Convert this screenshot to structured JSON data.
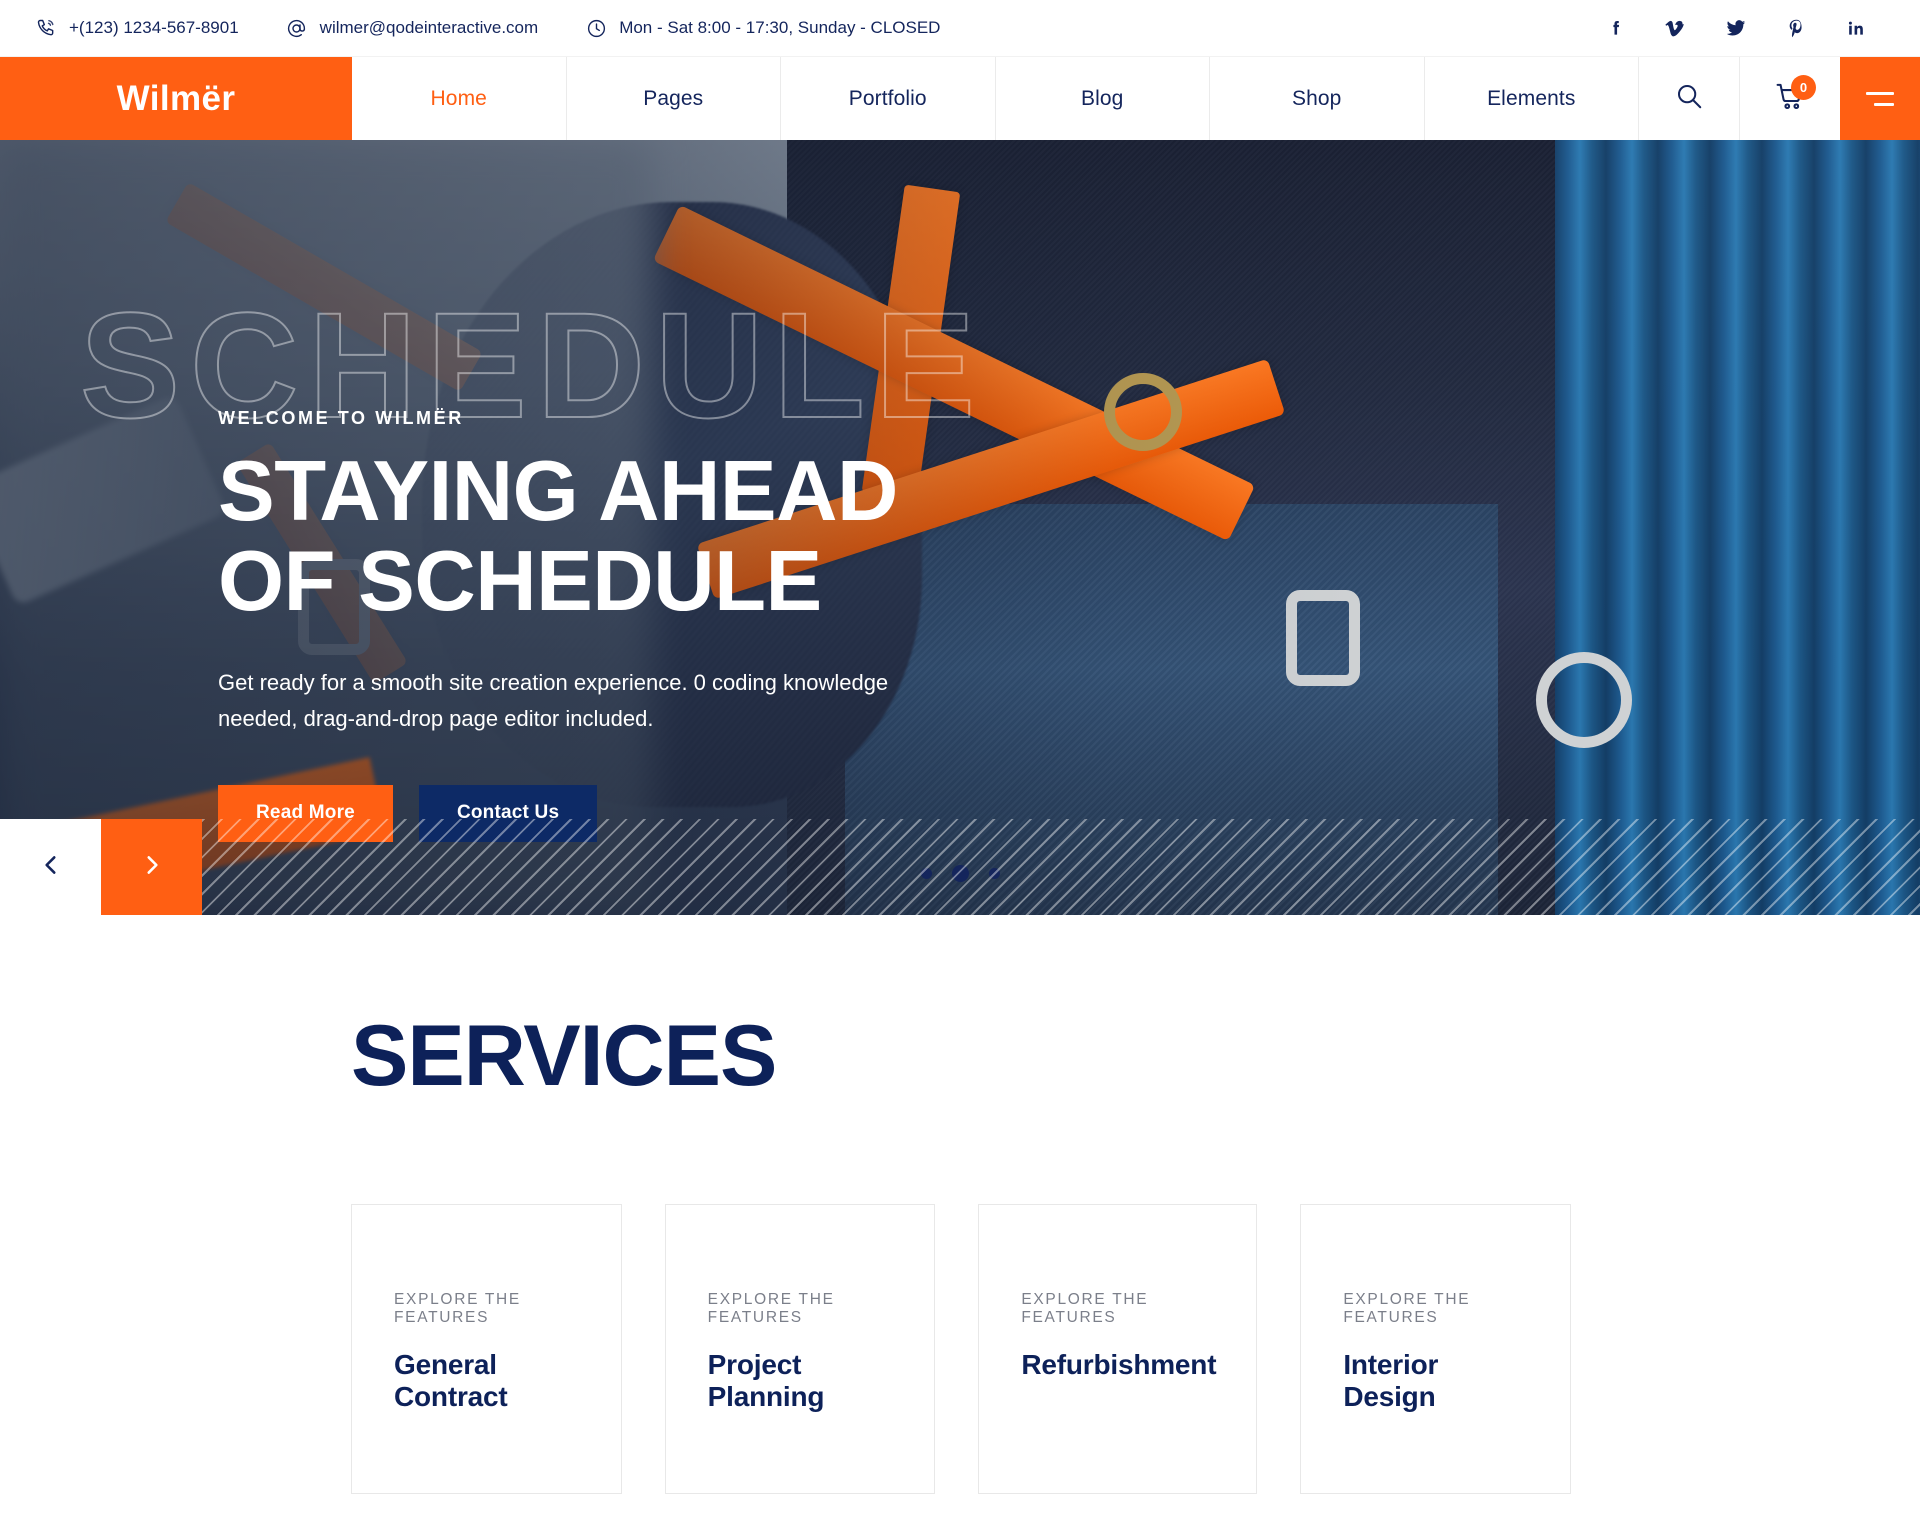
{
  "topbar": {
    "phone": "+(123) 1234-567-8901",
    "email": "wilmer@qodeinteractive.com",
    "hours": "Mon - Sat 8:00 - 17:30, Sunday - CLOSED",
    "icons": {
      "phone": "phone-icon",
      "email": "at-sign-icon",
      "clock": "clock-icon"
    },
    "social": [
      {
        "name": "facebook-icon",
        "glyph": "f"
      },
      {
        "name": "vimeo-icon",
        "glyph": "V"
      },
      {
        "name": "twitter-icon",
        "glyph": "t"
      },
      {
        "name": "pinterest-icon",
        "glyph": "P"
      },
      {
        "name": "linkedin-icon",
        "glyph": "in"
      }
    ]
  },
  "nav": {
    "logo": "Wilmër",
    "items": [
      {
        "label": "Home",
        "active": true
      },
      {
        "label": "Pages",
        "active": false
      },
      {
        "label": "Portfolio",
        "active": false
      },
      {
        "label": "Blog",
        "active": false
      },
      {
        "label": "Shop",
        "active": false
      },
      {
        "label": "Elements",
        "active": false
      }
    ],
    "search_icon": "search-icon",
    "cart_icon": "cart-icon",
    "cart_count": "0",
    "menu_icon": "hamburger-icon"
  },
  "hero": {
    "watermark": "SCHEDULE",
    "eyebrow": "WELCOME TO WILMËR",
    "title_line1": "STAYING AHEAD",
    "title_line2": "OF SCHEDULE",
    "subtitle": "Get ready for a smooth site creation experience. 0 coding knowledge needed, drag-and-drop page editor included.",
    "primary_button": "Read More",
    "secondary_button": "Contact Us",
    "prev_icon": "chevron-left-icon",
    "next_icon": "chevron-right-icon",
    "slides": 3,
    "active_slide": 2
  },
  "services": {
    "heading": "SERVICES",
    "cards": [
      {
        "eyebrow": "EXPLORE THE FEATURES",
        "name": "General Contract"
      },
      {
        "eyebrow": "EXPLORE THE FEATURES",
        "name": "Project Planning"
      },
      {
        "eyebrow": "EXPLORE THE FEATURES",
        "name": "Refurbishment"
      },
      {
        "eyebrow": "EXPLORE THE FEATURES",
        "name": "Interior Design"
      }
    ]
  },
  "colors": {
    "accent_orange": "#ff5f13",
    "navy": "#14255c",
    "deep_navy": "#0d2159",
    "button_navy": "#0d2a66",
    "muted_gray": "#7b7f8a"
  }
}
